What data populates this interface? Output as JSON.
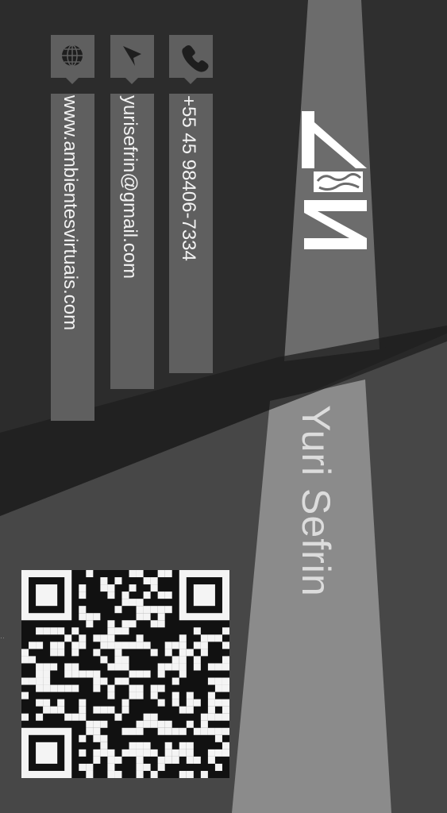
{
  "card": {
    "logo_text": "AVS",
    "name": "Yuri Sefrin",
    "contacts": [
      {
        "icon": "phone-icon",
        "value": "+55 45 98406-7334"
      },
      {
        "icon": "location-arrow-icon",
        "value": "yurisefrin@gmail.com"
      },
      {
        "icon": "globe-icon",
        "value": "www.ambientesvirtuais.com"
      }
    ]
  },
  "colors": {
    "background_dark": "#2b2b2b",
    "band_mid": "#6a6a6a",
    "band_light": "#8c8c8c",
    "panel": "#626262",
    "text_light": "#f2f2f2"
  }
}
